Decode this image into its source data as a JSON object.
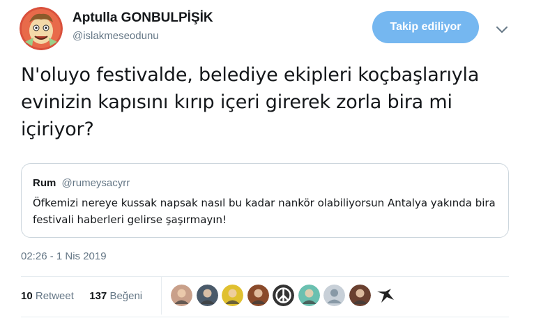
{
  "author": {
    "display_name": "Aptulla GONBULPİŞİK",
    "handle": "@islakmeseodunu",
    "avatar_icon": "cartoon-avatar-icon"
  },
  "follow_button": {
    "label": "Takip ediliyor",
    "color": "#75b7f0"
  },
  "menu_icon": "chevron-down-icon",
  "tweet": {
    "text": "N'oluyo festivalde, belediye ekipleri koçbaşlarıyla evinizin kapısını kırıp içeri girerek zorla bira mi içiriyor?"
  },
  "quoted_tweet": {
    "name": "Rum",
    "handle": "@rumeysacyrr",
    "text": "Öfkemizi nereye kussak napsak nasıl bu kadar nankör olabiliyorsun Antalya yakında bira festivali haberleri gelirse şaşırmayın!"
  },
  "timestamp": "02:26 - 1 Nis 2019",
  "stats": {
    "retweets_count": "10",
    "retweets_label": "Retweet",
    "likes_count": "137",
    "likes_label": "Beğeni"
  },
  "liker_avatars": [
    {
      "icon": "user-avatar-icon",
      "color": "#c9a08a"
    },
    {
      "icon": "user-avatar-icon",
      "color": "#4a5a6a"
    },
    {
      "icon": "user-avatar-icon",
      "color": "#e0c030"
    },
    {
      "icon": "user-avatar-icon",
      "color": "#8a4a2a"
    },
    {
      "icon": "peace-sign-icon",
      "color": "#333333"
    },
    {
      "icon": "user-avatar-icon",
      "color": "#6ac0b0"
    },
    {
      "icon": "default-avatar-icon",
      "color": "#c8d0d8"
    },
    {
      "icon": "user-avatar-icon",
      "color": "#6a4030"
    },
    {
      "icon": "bird-icon",
      "color": "#222222"
    }
  ]
}
